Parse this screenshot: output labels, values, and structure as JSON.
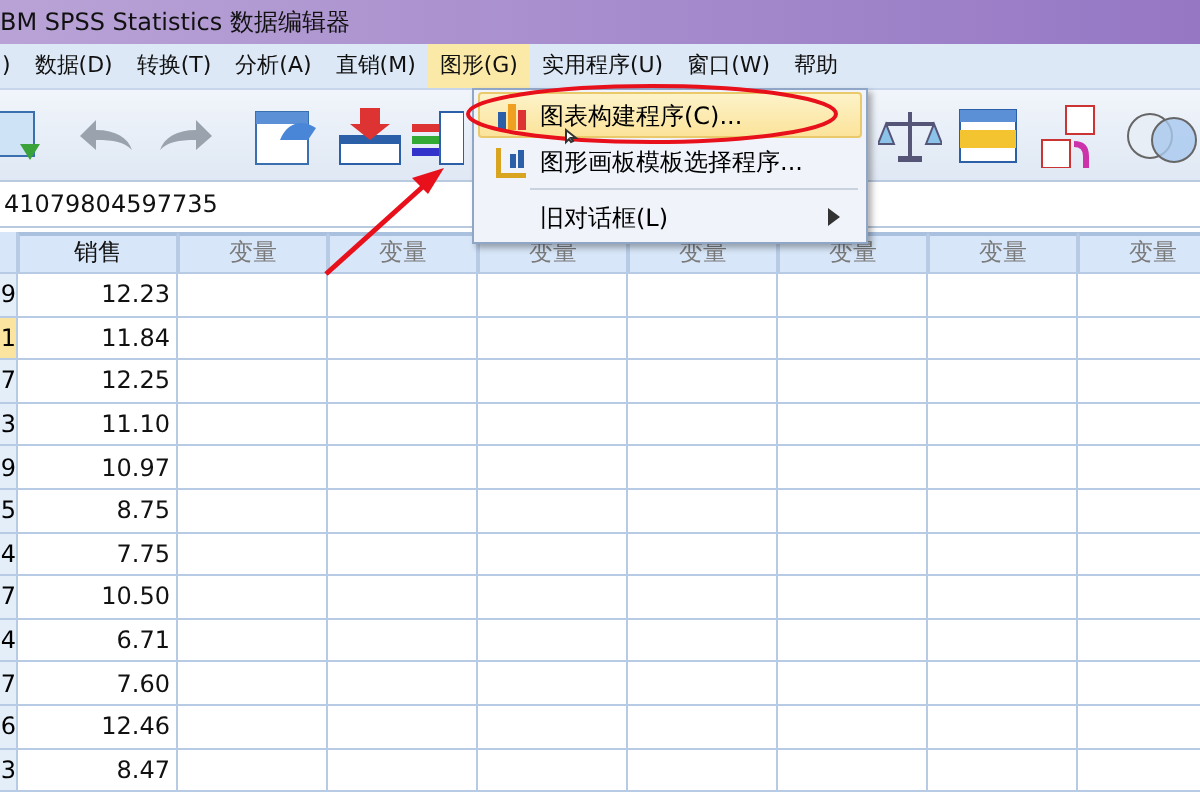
{
  "window": {
    "title": "BM SPSS Statistics 数据编辑器"
  },
  "menu": [
    {
      "label": ")",
      "open": false
    },
    {
      "label": "数据(D)",
      "open": false
    },
    {
      "label": "转换(T)",
      "open": false
    },
    {
      "label": "分析(A)",
      "open": false
    },
    {
      "label": "直销(M)",
      "open": false
    },
    {
      "label": "图形(G)",
      "open": true
    },
    {
      "label": "实用程序(U)",
      "open": false
    },
    {
      "label": "窗口(W)",
      "open": false
    },
    {
      "label": "帮助",
      "open": false
    }
  ],
  "cell_editor": {
    "value": "41079804597735"
  },
  "columns": [
    {
      "label": "销售",
      "kind": "defined"
    },
    {
      "label": "变量",
      "kind": "empty"
    },
    {
      "label": "变量",
      "kind": "empty"
    },
    {
      "label": "变量",
      "kind": "empty"
    },
    {
      "label": "变量",
      "kind": "empty"
    },
    {
      "label": "变量",
      "kind": "empty"
    },
    {
      "label": "变量",
      "kind": "empty"
    },
    {
      "label": "变量",
      "kind": "empty"
    }
  ],
  "rows": [
    {
      "column_1": "9",
      "sales": "12.23",
      "selected": false
    },
    {
      "column_1": "1",
      "sales": "11.84",
      "selected": true
    },
    {
      "column_1": "7",
      "sales": "12.25",
      "selected": false
    },
    {
      "column_1": "3",
      "sales": "11.10",
      "selected": false
    },
    {
      "column_1": "9",
      "sales": "10.97",
      "selected": false
    },
    {
      "column_1": "5",
      "sales": "8.75",
      "selected": false
    },
    {
      "column_1": "4",
      "sales": "7.75",
      "selected": false
    },
    {
      "column_1": "7",
      "sales": "10.50",
      "selected": false
    },
    {
      "column_1": "4",
      "sales": "6.71",
      "selected": false
    },
    {
      "column_1": "7",
      "sales": "7.60",
      "selected": false
    },
    {
      "column_1": "6",
      "sales": "12.46",
      "selected": false
    },
    {
      "column_1": "3",
      "sales": "8.47",
      "selected": false
    }
  ],
  "dropdown": {
    "items": [
      {
        "kind": "item",
        "label": "图表构建程序(C)...",
        "highlighted": true
      },
      {
        "kind": "item",
        "label": "图形画板模板选择程序...",
        "highlighted": false
      },
      {
        "kind": "separator"
      },
      {
        "kind": "submenu",
        "label": "旧对话框(L)",
        "highlighted": false
      }
    ]
  }
}
